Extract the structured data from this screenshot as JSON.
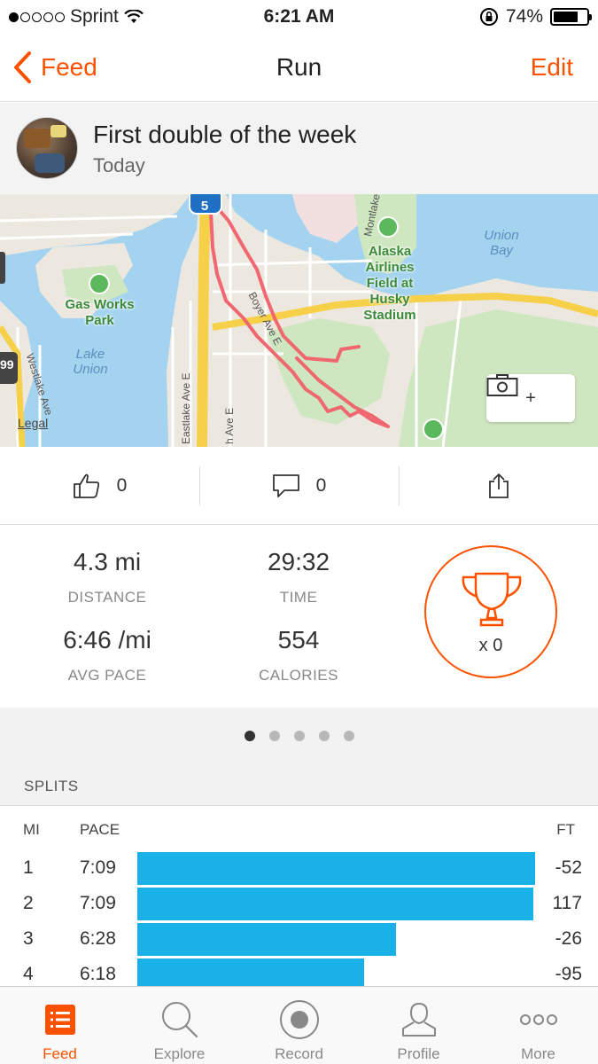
{
  "status_bar": {
    "carrier": "Sprint",
    "time": "6:21 AM",
    "battery": "74%"
  },
  "nav": {
    "back_label": "Feed",
    "title": "Run",
    "edit_label": "Edit"
  },
  "activity": {
    "title": "First double of the week",
    "date": "Today"
  },
  "map": {
    "labels": {
      "gas_works": "Gas Works\nPark",
      "lake_union": "Lake\nUnion",
      "union_bay": "Union\nBay",
      "husky": "Alaska\nAirlines\nField at\nHusky\nStadium",
      "eastlake": "Eastlake Ave E",
      "westlake": "Westlake Ave",
      "boyer": "Boyer Ave E",
      "montlake": "Montlake",
      "harvard": "h Ave E",
      "interstate": "5",
      "route_99": "99",
      "legal": "Legal"
    },
    "camera_plus": "+"
  },
  "social": {
    "kudos_count": "0",
    "comment_count": "0"
  },
  "stats": {
    "distance": {
      "value": "4.3 mi",
      "label": "DISTANCE"
    },
    "time": {
      "value": "29:32",
      "label": "TIME"
    },
    "pace": {
      "value": "6:46 /mi",
      "label": "AVG PACE"
    },
    "calories": {
      "value": "554",
      "label": "CALORIES"
    },
    "achievements": "x 0"
  },
  "pager": {
    "count": 5,
    "active": 0
  },
  "splits": {
    "title": "SPLITS",
    "headers": {
      "mi": "MI",
      "pace": "PACE",
      "ft": "FT"
    },
    "rows": [
      {
        "mi": "1",
        "pace": "7:09",
        "ft": "-52",
        "bar_fraction": 1.0
      },
      {
        "mi": "2",
        "pace": "7:09",
        "ft": "117",
        "bar_fraction": 0.995
      },
      {
        "mi": "3",
        "pace": "6:28",
        "ft": "-26",
        "bar_fraction": 0.65
      },
      {
        "mi": "4",
        "pace": "6:18",
        "ft": "-95",
        "bar_fraction": 0.57
      }
    ]
  },
  "tabs": [
    {
      "label": "Feed",
      "icon": "feed-icon",
      "active": true
    },
    {
      "label": "Explore",
      "icon": "search-icon",
      "active": false
    },
    {
      "label": "Record",
      "icon": "record-icon",
      "active": false
    },
    {
      "label": "Profile",
      "icon": "profile-icon",
      "active": false
    },
    {
      "label": "More",
      "icon": "more-icon",
      "active": false
    }
  ],
  "colors": {
    "accent": "#fc5200",
    "split_bar": "#1ab0e8",
    "route": "#f0606a"
  }
}
